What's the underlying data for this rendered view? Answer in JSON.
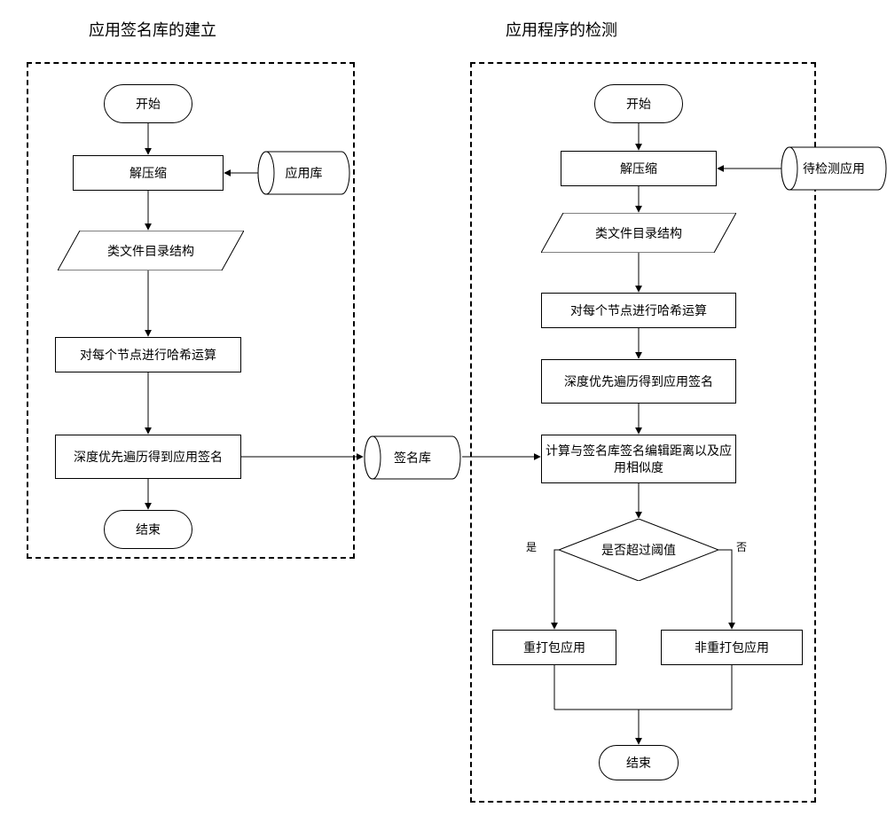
{
  "titles": {
    "left": "应用签名库的建立",
    "right": "应用程序的检测"
  },
  "left": {
    "start": "开始",
    "decompress": "解压缩",
    "store_app": "应用库",
    "dir_struct": "类文件目录结构",
    "hash_nodes": "对每个节点进行哈希运算",
    "dfs_sign": "深度优先遍历得到应用签名",
    "end": "结束"
  },
  "center": {
    "sig_store": "签名库"
  },
  "right": {
    "start": "开始",
    "decompress": "解压缩",
    "store_app_to_detect": "待检测应用",
    "dir_struct": "类文件目录结构",
    "hash_nodes": "对每个节点进行哈希运算",
    "dfs_sign": "深度优先遍历得到应用签名",
    "calc_dist": "计算与签名库签名编辑距离以及应用相似度",
    "decision": "是否超过阈值",
    "decision_yes": "是",
    "decision_no": "否",
    "repack": "重打包应用",
    "not_repack": "非重打包应用",
    "end": "结束"
  }
}
